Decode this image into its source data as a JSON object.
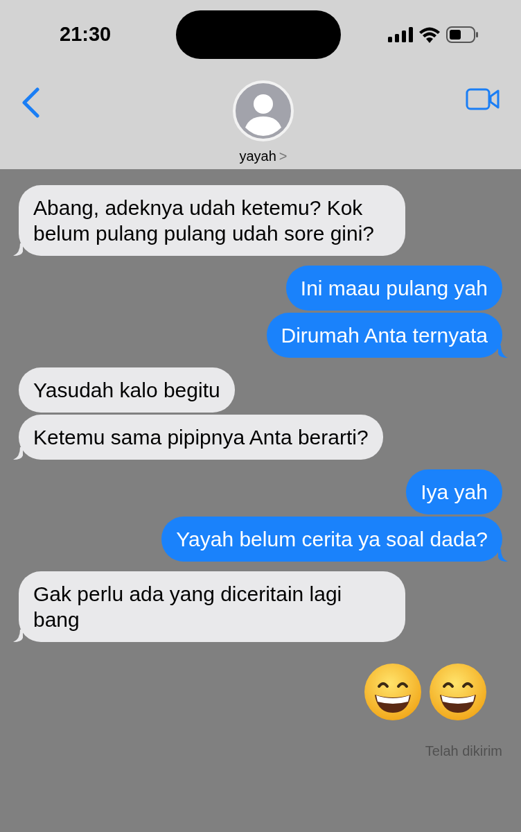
{
  "status_bar": {
    "time": "21:30"
  },
  "header": {
    "contact": "yayah",
    "chevron": ">"
  },
  "messages": [
    {
      "kind": "received",
      "text": "Abang, adeknya udah ketemu? Kok belum pulang pulang udah sore gini?"
    },
    {
      "kind": "sent",
      "text": "Ini maau pulang yah"
    },
    {
      "kind": "sent",
      "text": "Dirumah Anta ternyata"
    },
    {
      "kind": "received",
      "text": "Yasudah kalo begitu"
    },
    {
      "kind": "received",
      "text": "Ketemu sama pipipnya Anta berarti?"
    },
    {
      "kind": "sent",
      "text": "Iya yah"
    },
    {
      "kind": "sent",
      "text": "Yayah belum cerita ya soal dada?"
    },
    {
      "kind": "received",
      "text": "Gak perlu ada yang diceritain lagi bang"
    },
    {
      "kind": "emoji",
      "emojis": [
        {
          "kind": "grin"
        },
        {
          "kind": "grin"
        }
      ]
    }
  ],
  "delivery_status": "Telah dikirim"
}
